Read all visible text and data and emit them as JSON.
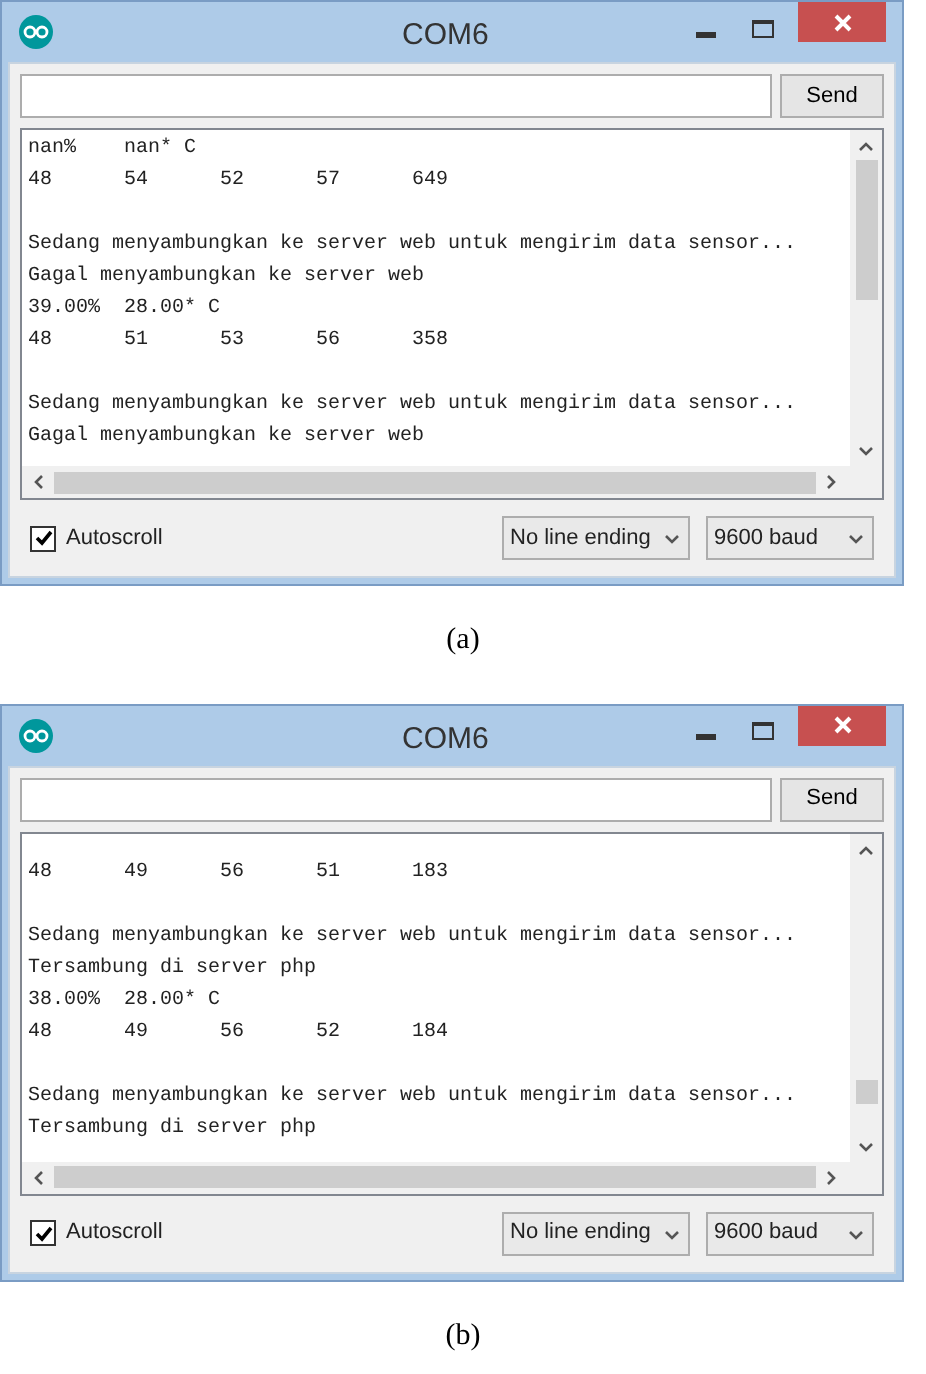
{
  "figures": [
    {
      "window": {
        "title": "COM6"
      },
      "send_button": "Send",
      "output_blocks": [
        [
          "nan%\tnan* C",
          "48\t54\t52\t57\t649"
        ],
        [
          "Sedang menyambungkan ke server web untuk mengirim data sensor...",
          "Gagal menyambungkan ke server web",
          "39.00%  28.00* C",
          "48\t51\t53\t56\t358"
        ],
        [
          "Sedang menyambungkan ke server web untuk mengirim data sensor...",
          "Gagal menyambungkan ke server web"
        ]
      ],
      "autoscroll": {
        "label": "Autoscroll",
        "checked": true
      },
      "line_ending": "No line ending",
      "baud": "9600 baud",
      "caption": "(a)"
    },
    {
      "window": {
        "title": "COM6"
      },
      "send_button": "Send",
      "output_blocks": [
        [
          "48\t49\t56\t51\t183"
        ],
        [
          "Sedang menyambungkan ke server web untuk mengirim data sensor...",
          "Tersambung di server php",
          "38.00%  28.00* C",
          "48\t49\t56\t52\t184"
        ],
        [
          "Sedang menyambungkan ke server web untuk mengirim data sensor...",
          "Tersambung di server php"
        ]
      ],
      "autoscroll": {
        "label": "Autoscroll",
        "checked": true
      },
      "line_ending": "No line ending",
      "baud": "9600 baud",
      "caption": "(b)"
    }
  ]
}
